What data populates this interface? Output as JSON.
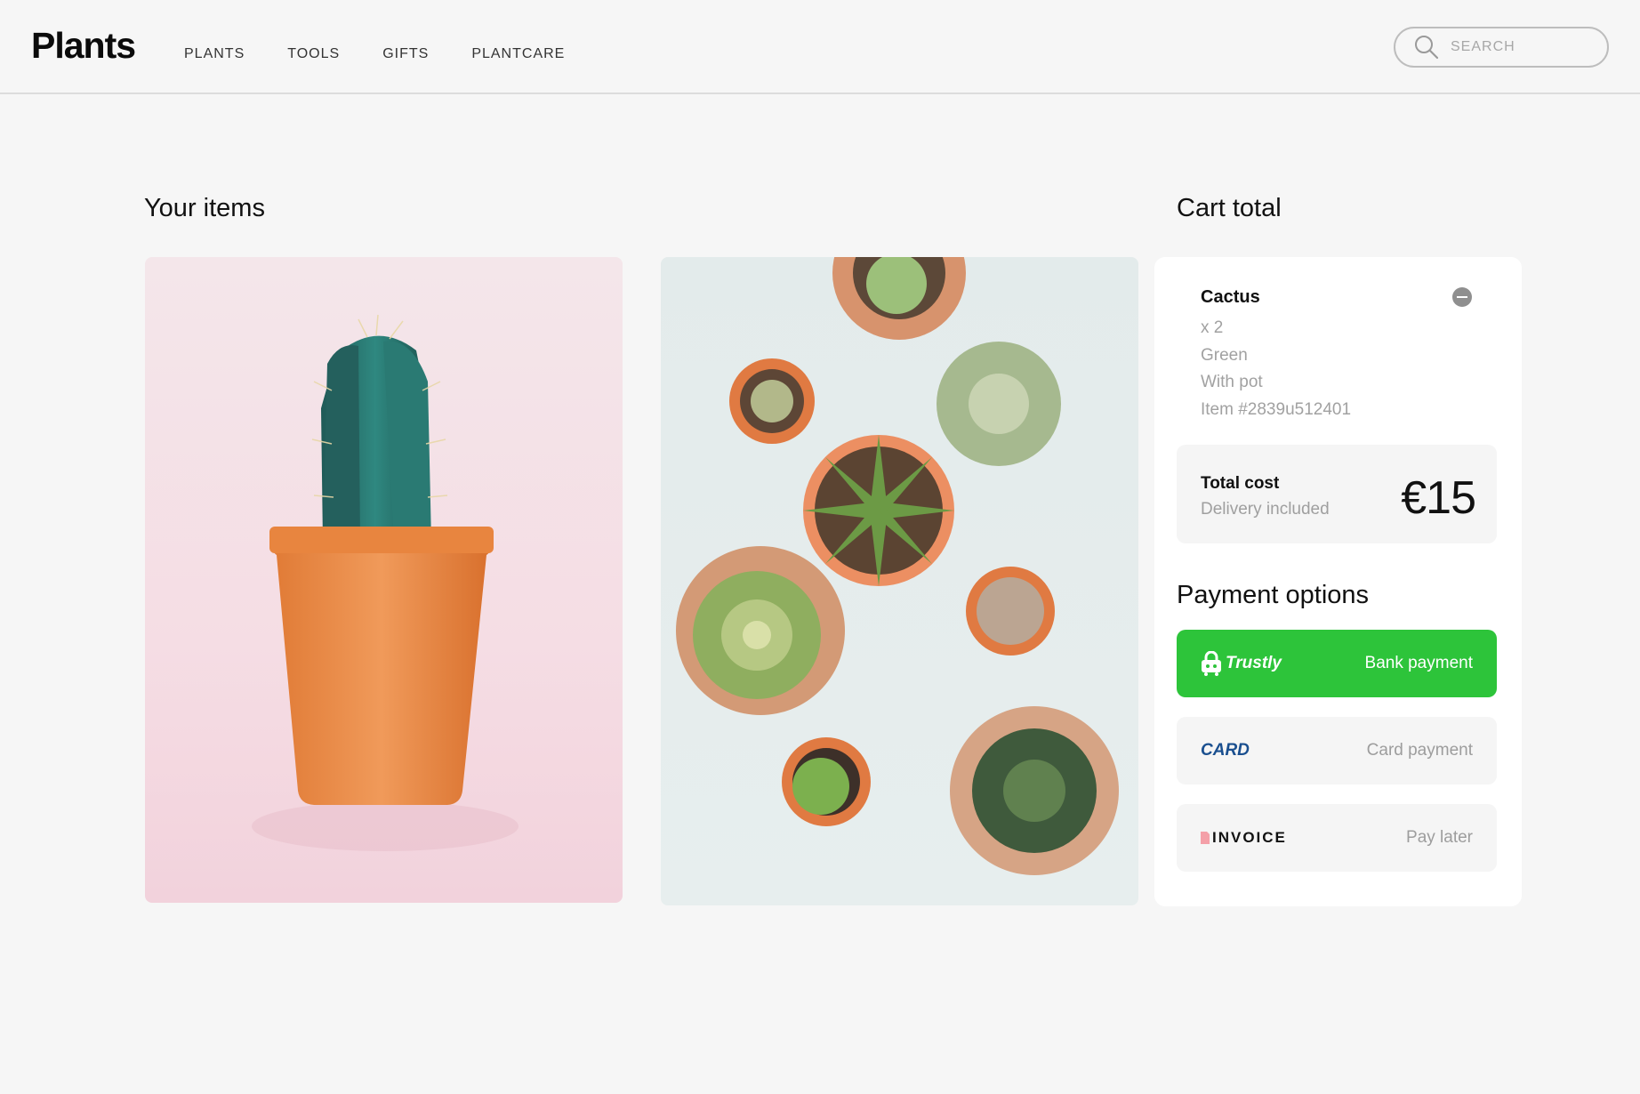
{
  "header": {
    "logo": "Plants",
    "nav": [
      "PLANTS",
      "TOOLS",
      "GIFTS",
      "PLANTCARE"
    ],
    "search_placeholder": "SEARCH"
  },
  "items_section": {
    "title": "Your items",
    "images": [
      "potted cactus",
      "succulents top view"
    ]
  },
  "cart": {
    "title": "Cart total",
    "item": {
      "name": "Cactus",
      "quantity": "x 2",
      "color": "Green",
      "option": "With pot",
      "item_number": "Item #2839u512401"
    },
    "total": {
      "label": "Total cost",
      "note": "Delivery included",
      "price": "€15"
    },
    "payment": {
      "title": "Payment options",
      "options": [
        {
          "brand": "Trustly",
          "label": "Bank payment",
          "color": "#2dc43a"
        },
        {
          "brand": "CARD",
          "label": "Card payment",
          "color": "#1a4f8f"
        },
        {
          "brand": "INVOICE",
          "label": "Pay later",
          "color": "#111111"
        }
      ]
    }
  }
}
